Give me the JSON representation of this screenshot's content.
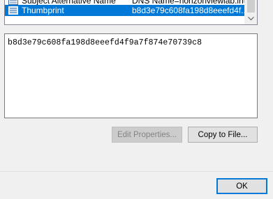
{
  "field_list": {
    "partial_row": {
      "field": "Subject Alternative Name",
      "value": "DNS Name=horizonviewlab.intl"
    },
    "selected_row": {
      "field": "Thumbprint",
      "value": "b8d3e79c608fa198d8eeefd4f..."
    }
  },
  "value_box": {
    "text": "b8d3e79c608fa198d8eeefd4f9a7f874e70739c8"
  },
  "buttons": {
    "edit_properties": "Edit Properties...",
    "copy_to_file": "Copy to File...",
    "ok": "OK"
  },
  "colors": {
    "selection": "#0078d7",
    "disabled_text": "#838383"
  },
  "icons": {
    "cert_field": "certificate-field-icon",
    "scroll_down": "chevron-down-icon"
  }
}
